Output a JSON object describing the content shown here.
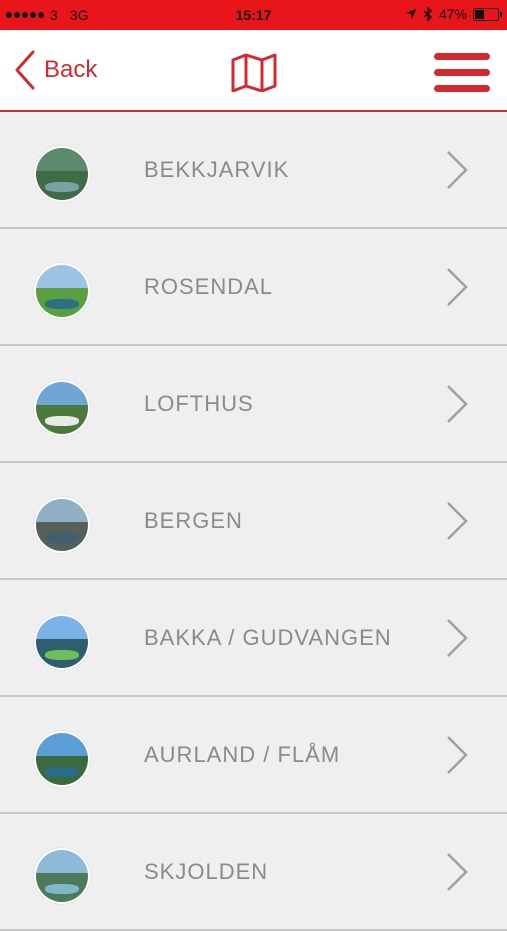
{
  "status_bar": {
    "carrier": "3",
    "network": "3G",
    "time": "15:17",
    "battery_text": "47%",
    "battery_level": 0.47
  },
  "navbar": {
    "back_label": "Back",
    "map_icon": "map-icon",
    "menu_icon": "hamburger-menu-icon",
    "accent_color": "#d42a2e"
  },
  "list": {
    "items": [
      {
        "label": "BEKKJARVIK"
      },
      {
        "label": "ROSENDAL"
      },
      {
        "label": "LOFTHUS"
      },
      {
        "label": "BERGEN"
      },
      {
        "label": "BAKKA / GUDVANGEN"
      },
      {
        "label": "AURLAND / FLÅM"
      },
      {
        "label": "SKJOLDEN"
      }
    ]
  }
}
